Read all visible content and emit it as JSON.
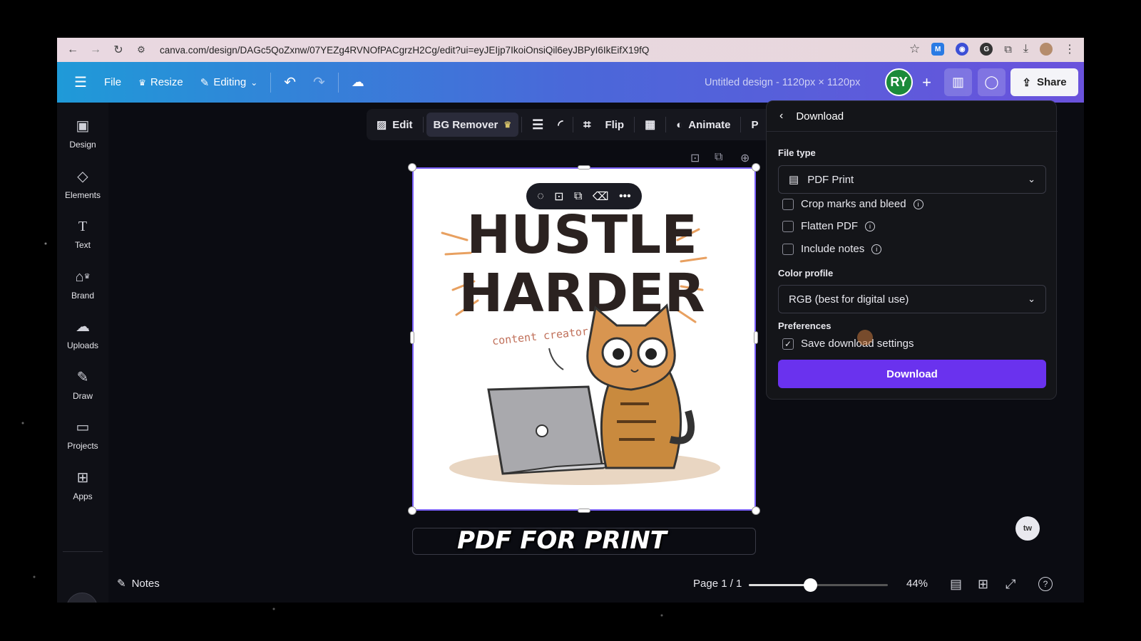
{
  "browser": {
    "url": "canva.com/design/DAGc5QoZxnw/07YEZg4RVNOfPACgrzH2Cg/edit?ui=eyJEIjp7IkoiOnsiQil6eyJBPyI6IkEifX19fQ"
  },
  "topbar": {
    "file_label": "File",
    "resize_label": "Resize",
    "editing_label": "Editing",
    "title": "Untitled design - 1120px × 1120px",
    "avatar_initials": "RY",
    "share_label": "Share"
  },
  "sidebar": {
    "items": [
      {
        "label": "Design",
        "icon": "design-icon"
      },
      {
        "label": "Elements",
        "icon": "elements-icon"
      },
      {
        "label": "Text",
        "icon": "text-icon"
      },
      {
        "label": "Brand",
        "icon": "brand-icon"
      },
      {
        "label": "Uploads",
        "icon": "uploads-icon"
      },
      {
        "label": "Draw",
        "icon": "draw-icon"
      },
      {
        "label": "Projects",
        "icon": "projects-icon"
      },
      {
        "label": "Apps",
        "icon": "apps-icon"
      }
    ]
  },
  "context_toolbar": {
    "edit_label": "Edit",
    "bg_remover_label": "BG Remover",
    "flip_label": "Flip",
    "animate_label": "Animate",
    "cut_label": "P"
  },
  "artwork": {
    "line1": "HUSTLE",
    "line2": "HARDER",
    "note": "content creator"
  },
  "caption": "PDF FOR PRINT",
  "download_panel": {
    "title": "Download",
    "file_type_label": "File type",
    "file_type_value": "PDF Print",
    "options": [
      {
        "label": "Crop marks and bleed",
        "checked": false
      },
      {
        "label": "Flatten PDF",
        "checked": false
      },
      {
        "label": "Include notes",
        "checked": false
      }
    ],
    "color_profile_label": "Color profile",
    "color_profile_value": "RGB (best for digital use)",
    "preferences_label": "Preferences",
    "save_settings_label": "Save download settings",
    "save_settings_checked": true,
    "download_button": "Download"
  },
  "bottombar": {
    "notes_label": "Notes",
    "page_label": "Page 1 / 1",
    "zoom": "44%",
    "zoom_fraction": 0.44
  },
  "colors": {
    "accent": "#6a32ee",
    "selection": "#7b61ff",
    "topbar_start": "#1f9ad8",
    "topbar_end": "#6a52dc"
  }
}
